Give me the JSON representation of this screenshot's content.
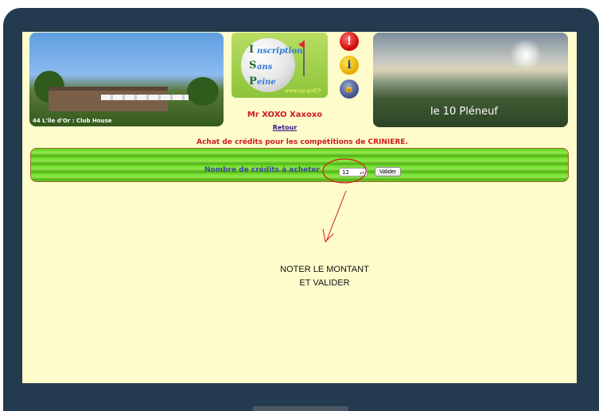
{
  "header": {
    "left_photo_caption": "44 L'île d'Or : Club House",
    "right_photo_caption": "le 10 Pléneuf",
    "logo": {
      "words": [
        "nscription",
        "ans",
        "eine"
      ],
      "letters": [
        "I",
        "S",
        "P"
      ],
      "url": "www.isp-golf.fr"
    },
    "icons": {
      "stop": "stop-icon",
      "info": "info-icon",
      "lock": "lock-icon",
      "info_glyph": "i",
      "stop_glyph": "!",
      "lock_glyph": "🔒"
    }
  },
  "user": {
    "name": "Mr XOXO Xaxoxo",
    "back_label": "Retour"
  },
  "page": {
    "heading": "Achat de crédits pour les compétitions de CRINIERE."
  },
  "form": {
    "credits_label": "Nombre de crédits à acheter",
    "credits_value": "12",
    "submit_label": "Valider"
  },
  "annotation": {
    "line1": "NOTER LE MONTANT",
    "line2": "ET  VALIDER",
    "color": "#d11a1a"
  },
  "colors": {
    "page_bg": "#fffccc",
    "frame": "#233a4f",
    "accent_red": "#cc1b1b",
    "panel_green": "#5fd11d"
  }
}
